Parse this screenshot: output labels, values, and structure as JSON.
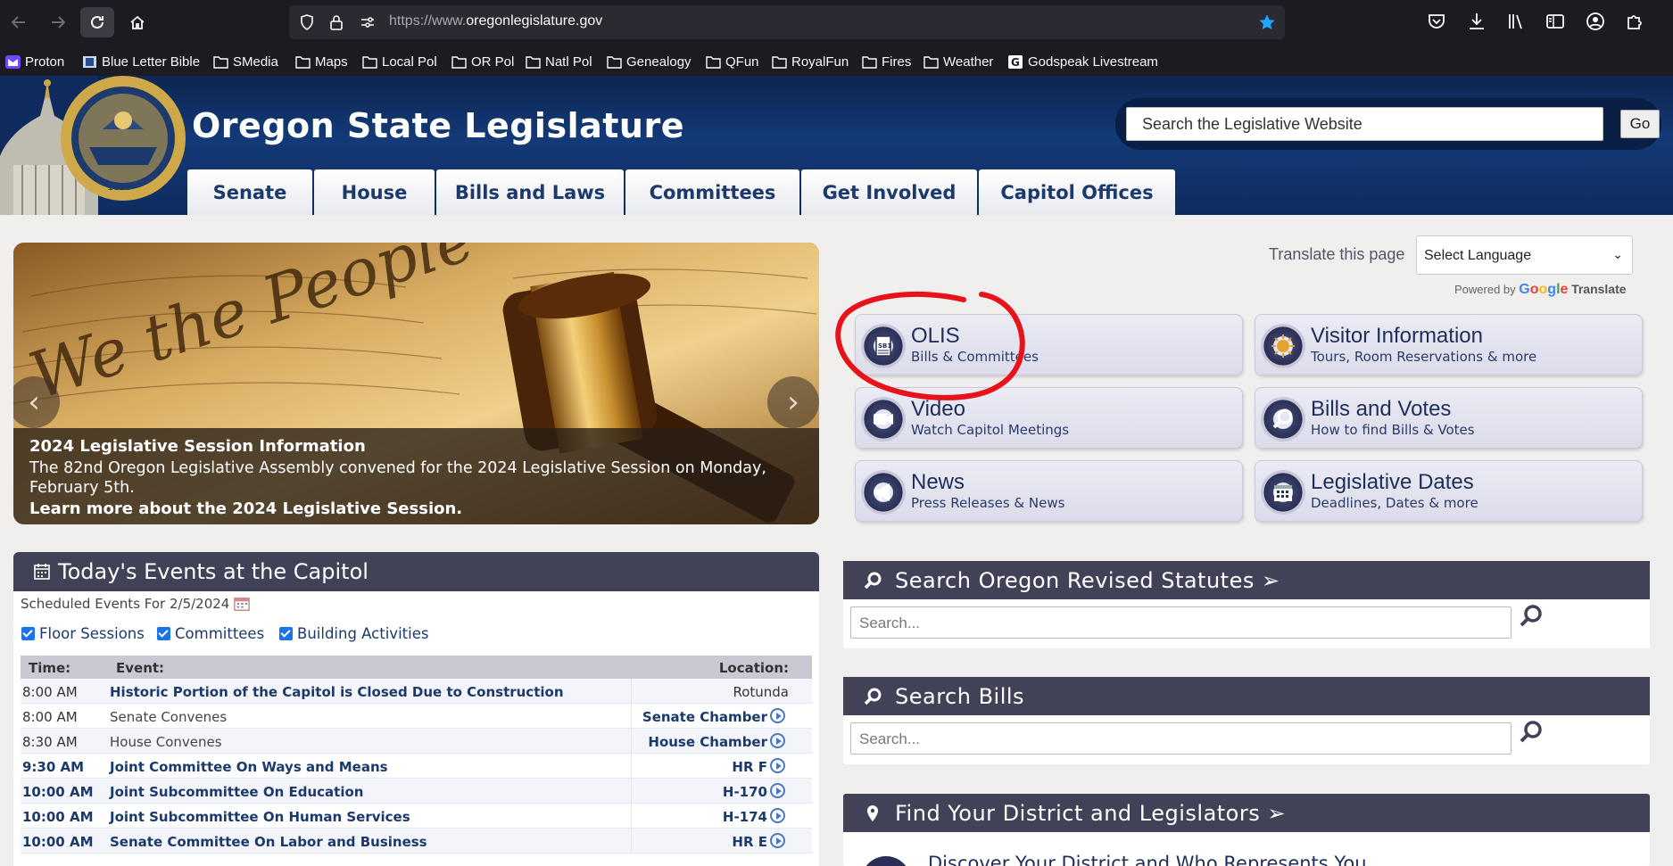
{
  "browser": {
    "url_prefix": "https://www.",
    "url_domain": "oregonlegislature.gov",
    "bookmarks": [
      {
        "label": "Proton",
        "icon": "proton-icon"
      },
      {
        "label": "Blue Letter Bible",
        "icon": "blb-icon"
      },
      {
        "label": "SMedia",
        "icon": "folder-icon"
      },
      {
        "label": "Maps",
        "icon": "folder-icon"
      },
      {
        "label": "Local Pol",
        "icon": "folder-icon"
      },
      {
        "label": "OR Pol",
        "icon": "folder-icon"
      },
      {
        "label": "Natl Pol",
        "icon": "folder-icon"
      },
      {
        "label": "Genealogy",
        "icon": "folder-icon"
      },
      {
        "label": "QFun",
        "icon": "folder-icon"
      },
      {
        "label": "RoyalFun",
        "icon": "folder-icon"
      },
      {
        "label": "Fires",
        "icon": "folder-icon"
      },
      {
        "label": "Weather",
        "icon": "folder-icon"
      },
      {
        "label": "Godspeak Livestream",
        "icon": "g-icon"
      }
    ]
  },
  "header": {
    "title": "Oregon State Legislature",
    "search_placeholder": "Search the Legislative Website",
    "go_label": "Go",
    "tabs": [
      "Senate",
      "House",
      "Bills and Laws",
      "Committees",
      "Get Involved",
      "Capitol Offices"
    ]
  },
  "carousel": {
    "title": "2024 Legislative Session Information",
    "body": "The 82nd Oregon Legislative Assembly convened for the 2024 Legislative Session on Monday, February 5th.",
    "link": "Learn more about the 2024 Legislative Session."
  },
  "translate": {
    "label": "Translate this page",
    "select": "Select Language",
    "powered": "Powered by",
    "google": "Google",
    "translate_word": "Translate"
  },
  "tiles": [
    {
      "title": "OLIS",
      "sub": "Bills & Committees",
      "icon": "document-icon"
    },
    {
      "title": "Visitor Information",
      "sub": "Tours, Room Reservations & more",
      "icon": "sun-icon"
    },
    {
      "title": "Video",
      "sub": "Watch Capitol Meetings",
      "icon": "video-camera-icon"
    },
    {
      "title": "Bills and Votes",
      "sub": "How to find Bills & Votes",
      "icon": "magnifier-icon"
    },
    {
      "title": "News",
      "sub": "Press Releases & News",
      "icon": "megaphone-icon"
    },
    {
      "title": "Legislative Dates",
      "sub": "Deadlines, Dates & more",
      "icon": "calendar-icon"
    }
  ],
  "events": {
    "title": "Today's Events at the Capitol",
    "scheduled": "Scheduled Events For 2/5/2024",
    "filters": [
      "Floor Sessions",
      "Committees",
      "Building Activities"
    ],
    "headers": {
      "time": "Time:",
      "event": "Event:",
      "location": "Location:"
    },
    "rows": [
      {
        "time": "8:00 AM",
        "event": "Historic Portion of the Capitol is Closed Due to Construction",
        "location": "Rotunda"
      },
      {
        "time": "8:00 AM",
        "event": "Senate Convenes",
        "location": "Senate Chamber"
      },
      {
        "time": "8:30 AM",
        "event": "House Convenes",
        "location": "House Chamber"
      },
      {
        "time": "9:30 AM",
        "event": "Joint Committee On Ways and Means",
        "location": "HR F"
      },
      {
        "time": "10:00 AM",
        "event": "Joint Subcommittee On Education",
        "location": "H-170"
      },
      {
        "time": "10:00 AM",
        "event": "Joint Subcommittee On Human Services",
        "location": "H-174"
      },
      {
        "time": "10:00 AM",
        "event": "Senate Committee On Labor and Business",
        "location": "HR E"
      }
    ]
  },
  "panels": {
    "ors": {
      "title": "Search Oregon Revised Statutes ➢",
      "placeholder": "Search..."
    },
    "bills": {
      "title": "Search Bills",
      "placeholder": "Search..."
    },
    "district": {
      "title": "Find Your District and Legislators ➢",
      "sub": "Discover Your District and Who Represents You"
    }
  }
}
